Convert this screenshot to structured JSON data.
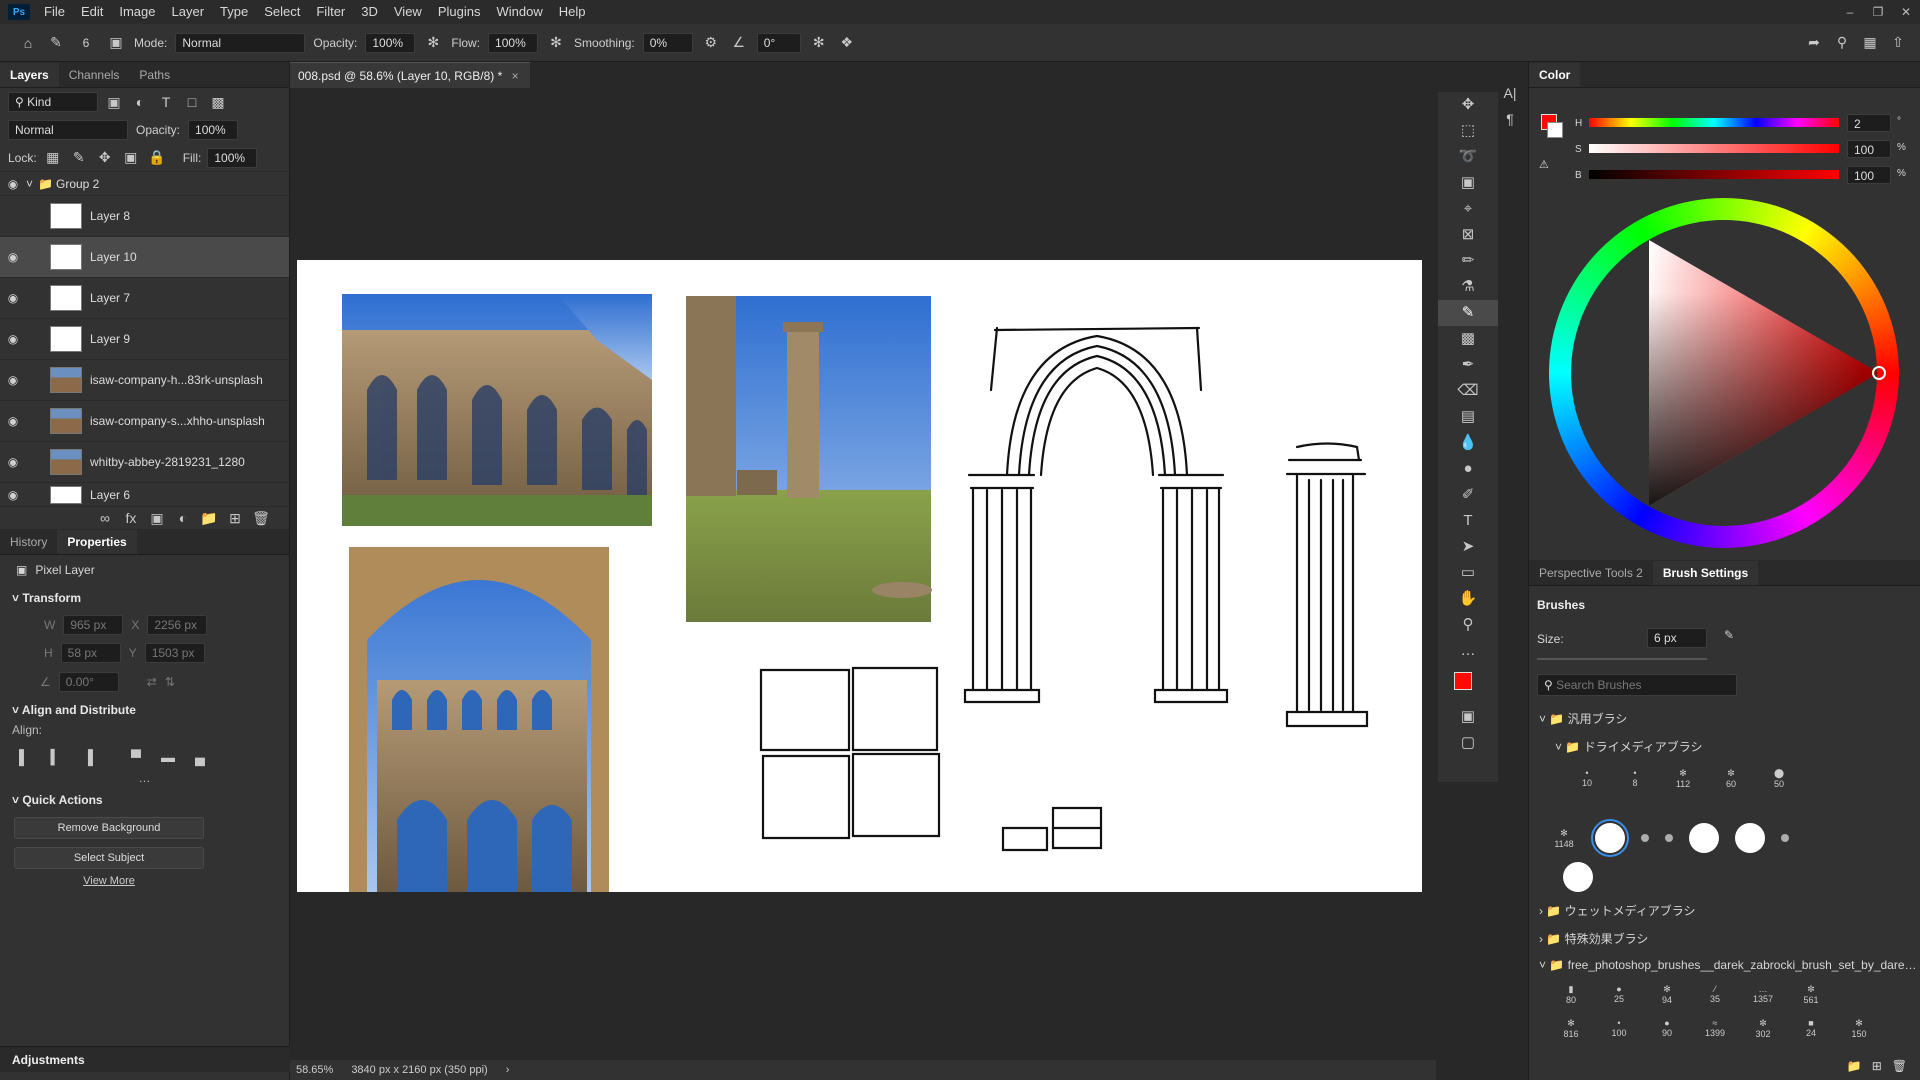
{
  "menubar": {
    "logo": "Ps",
    "items": [
      "File",
      "Edit",
      "Image",
      "Layer",
      "Type",
      "Select",
      "Filter",
      "3D",
      "View",
      "Plugins",
      "Window",
      "Help"
    ]
  },
  "options": {
    "brush_size": "6",
    "mode_label": "Mode:",
    "mode_value": "Normal",
    "opacity_label": "Opacity:",
    "opacity_value": "100%",
    "flow_label": "Flow:",
    "flow_value": "100%",
    "smoothing_label": "Smoothing:",
    "smoothing_value": "0%",
    "angle_value": "0°"
  },
  "layers_panel": {
    "tabs": [
      "Layers",
      "Channels",
      "Paths"
    ],
    "kind_label": "Kind",
    "blend_mode": "Normal",
    "opacity_label": "Opacity:",
    "opacity_value": "100%",
    "lock_label": "Lock:",
    "fill_label": "Fill:",
    "fill_value": "100%",
    "group": "Group 2",
    "layers": [
      {
        "name": "Layer 8",
        "visible": false
      },
      {
        "name": "Layer 10",
        "visible": true,
        "selected": true
      },
      {
        "name": "Layer 7",
        "visible": true
      },
      {
        "name": "Layer 9",
        "visible": true
      },
      {
        "name": "isaw-company-h...83rk-unsplash",
        "visible": true
      },
      {
        "name": "isaw-company-s...xhho-unsplash",
        "visible": true
      },
      {
        "name": "whitby-abbey-2819231_1280",
        "visible": true
      },
      {
        "name": "Layer 6",
        "visible": true
      }
    ]
  },
  "properties_panel": {
    "tabs": [
      "History",
      "Properties"
    ],
    "layer_type": "Pixel Layer",
    "transform_title": "Transform",
    "w_label": "W",
    "w_value": "965 px",
    "x_label": "X",
    "x_value": "2256 px",
    "h_label": "H",
    "h_value": "58 px",
    "y_label": "Y",
    "y_value": "1503 px",
    "angle_value": "0.00°",
    "align_title": "Align and Distribute",
    "align_label": "Align:",
    "quick_actions_title": "Quick Actions",
    "remove_bg": "Remove Background",
    "select_subject": "Select Subject",
    "view_more": "View More",
    "adjustments": "Adjustments"
  },
  "document": {
    "tab_title": "008.psd @ 58.6% (Layer 10, RGB/8) *",
    "zoom": "58.65%",
    "dimensions": "3840 px x 2160 px (350 ppi)"
  },
  "color_panel": {
    "title": "Color",
    "h_label": "H",
    "h_value": "2",
    "s_label": "S",
    "s_value": "100",
    "b_label": "B",
    "b_value": "100",
    "deg": "°",
    "pct": "%",
    "foreground": "#ff0a00",
    "background": "#ffffff"
  },
  "brush_panel": {
    "tabs": [
      "Perspective Tools 2",
      "Brush Settings"
    ],
    "title": "Brushes",
    "size_label": "Size:",
    "size_value": "6 px",
    "search_placeholder": "Search Brushes",
    "folders": [
      "汎用ブラシ",
      "ドライメディアブラシ",
      "ウェットメディアブラシ",
      "特殊効果ブラシ",
      "free_photoshop_brushes__darek_zabrocki_brush_set_by_darek..."
    ],
    "row1": [
      "10",
      "8",
      "112",
      "60",
      "50"
    ],
    "row2": [
      "1148"
    ],
    "row3": [
      "80",
      "25",
      "94",
      "35",
      "1357",
      "561"
    ],
    "row4": [
      "816",
      "100",
      "90",
      "1399",
      "302",
      "24",
      "150"
    ]
  }
}
